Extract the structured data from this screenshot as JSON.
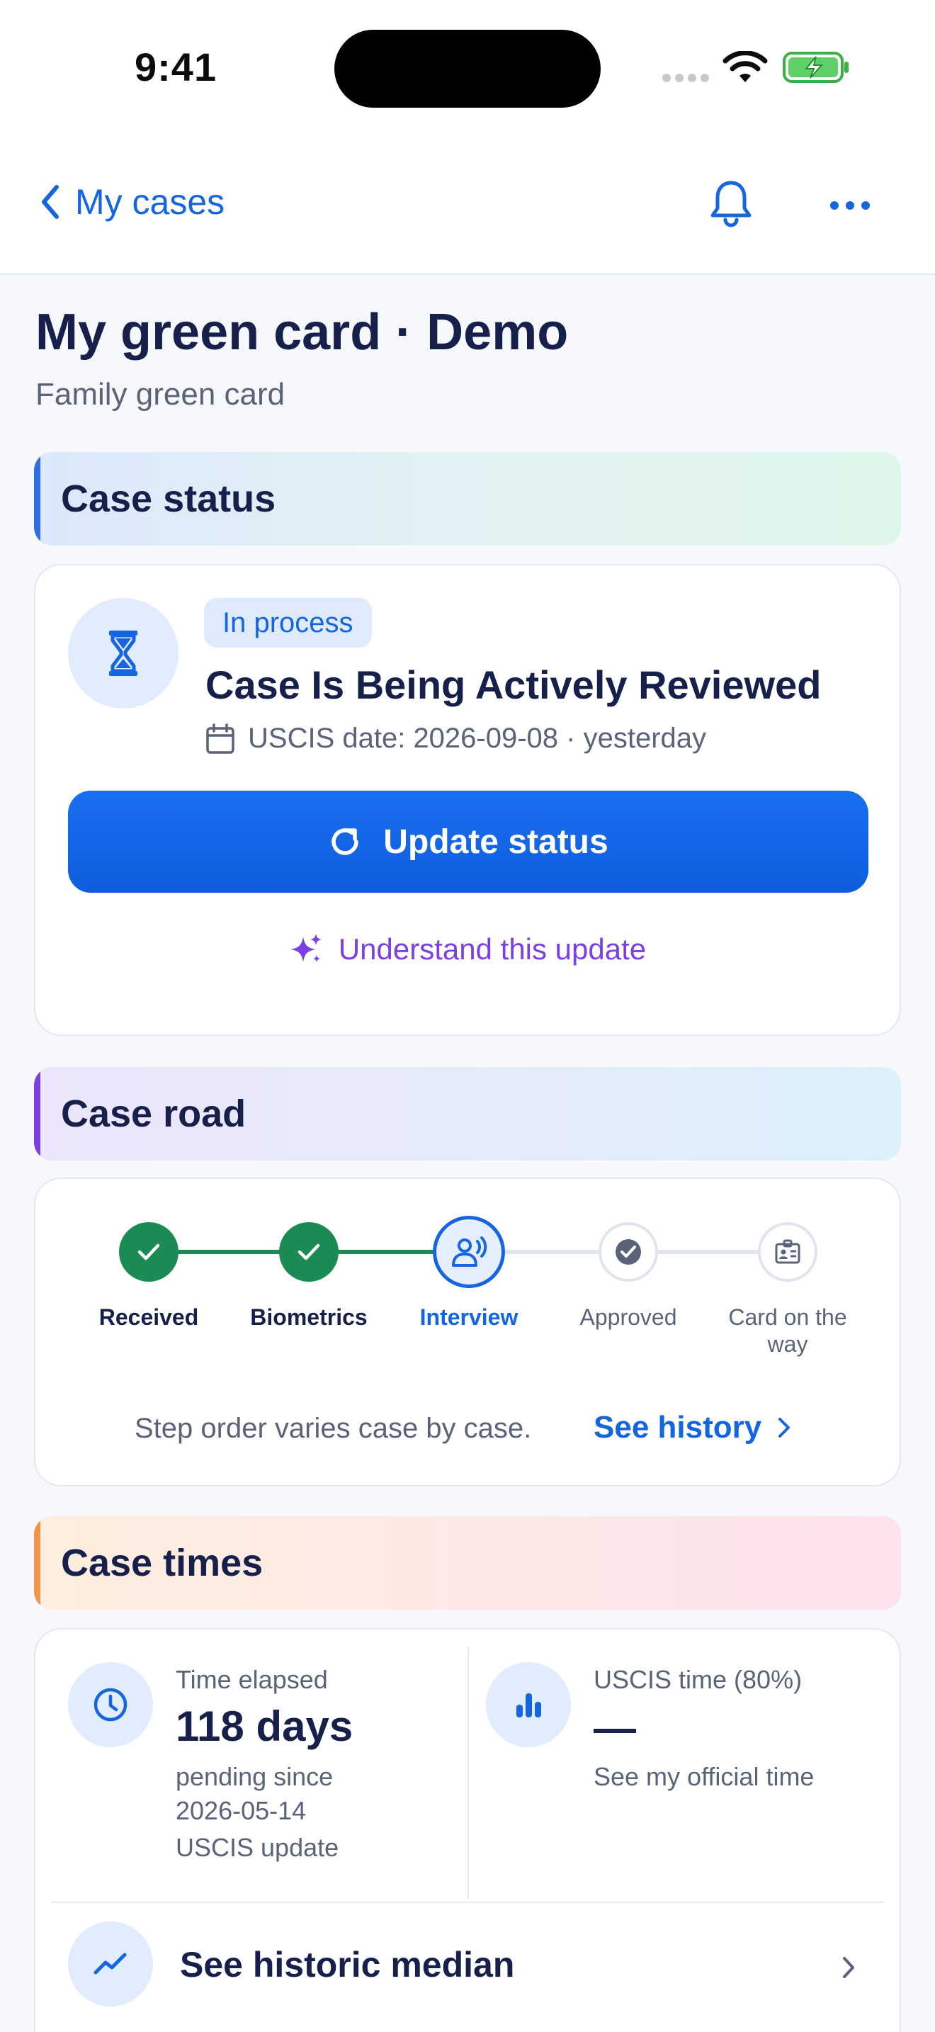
{
  "status_bar": {
    "time": "9:41"
  },
  "nav": {
    "back_label": "My cases"
  },
  "header": {
    "title": "My green card · Demo",
    "subtitle": "Family green card"
  },
  "sections": {
    "case_status": "Case status",
    "case_road": "Case road",
    "case_times": "Case times"
  },
  "status_card": {
    "badge": "In process",
    "title": "Case Is Being Actively Reviewed",
    "uscis_date": "USCIS date: 2026-09-08 · yesterday",
    "update_button": "Update status",
    "understand_link": "Understand this update"
  },
  "road": {
    "steps": [
      {
        "label": "Received",
        "state": "done"
      },
      {
        "label": "Biometrics",
        "state": "done"
      },
      {
        "label": "Interview",
        "state": "current"
      },
      {
        "label": "Approved",
        "state": "pending"
      },
      {
        "label": "Card on the way",
        "state": "pending"
      }
    ],
    "note": "Step order varies case by case.",
    "history_link": "See history"
  },
  "times": {
    "elapsed_label": "Time elapsed",
    "elapsed_value": "118 days",
    "elapsed_sub1": "pending since",
    "elapsed_sub2": "2026-05-14",
    "elapsed_sub3": "USCIS update",
    "uscis_label": "USCIS time (80%)",
    "uscis_value": "—",
    "uscis_sub": "See my official time",
    "median_label": "See historic median"
  },
  "colors": {
    "primary": "#1565e0",
    "done": "#1b8a55",
    "accent_purple": "#7b3fe4",
    "accent_orange": "#f0944a",
    "text_dark": "#16204a"
  },
  "icons": {
    "back": "chevron-left-icon",
    "notifications": "bell-icon",
    "more": "ellipsis-icon",
    "status": "hourglass-icon",
    "calendar": "calendar-icon",
    "refresh": "refresh-icon",
    "sparkle": "sparkle-icon",
    "clock": "clock-icon",
    "bar_chart": "bar-chart-icon",
    "trend": "trend-icon"
  }
}
